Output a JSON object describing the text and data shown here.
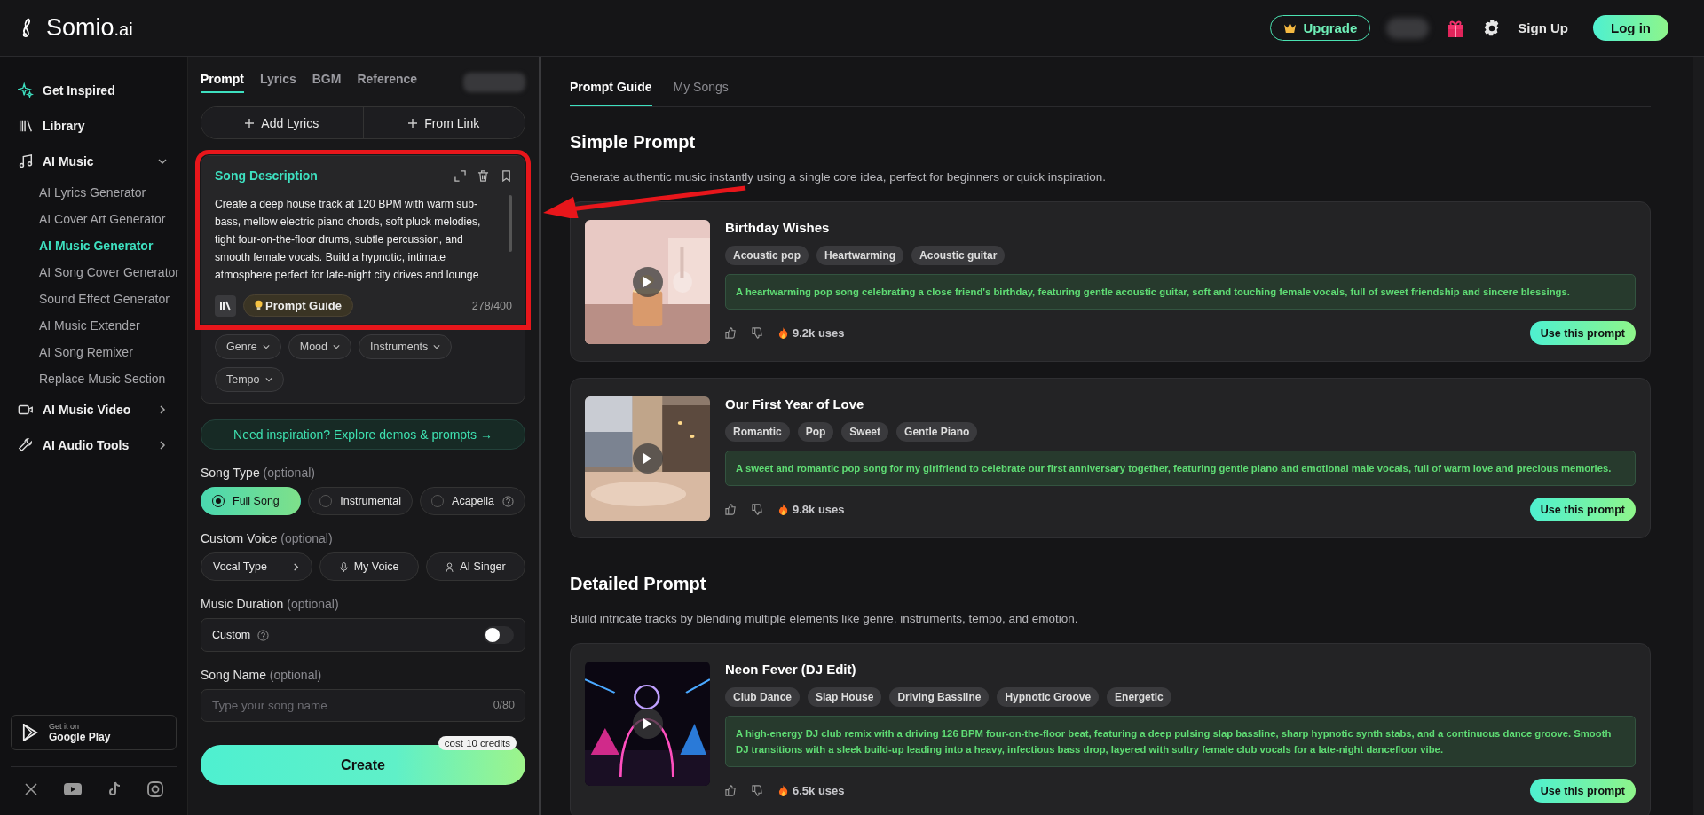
{
  "header": {
    "logo": "Somio",
    "logo_suffix": ".ai",
    "upgrade": "Upgrade",
    "sign_up": "Sign Up",
    "log_in": "Log in"
  },
  "sidebar": {
    "items": [
      {
        "label": "Get Inspired"
      },
      {
        "label": "Library"
      },
      {
        "label": "AI Music",
        "expanded": true,
        "children": [
          {
            "label": "AI Lyrics Generator",
            "selected": false
          },
          {
            "label": "AI Cover Art Generator",
            "selected": false
          },
          {
            "label": "AI Music Generator",
            "selected": true
          },
          {
            "label": "AI Song Cover Generator",
            "selected": false
          },
          {
            "label": "Sound Effect Generator",
            "selected": false
          },
          {
            "label": "AI Music Extender",
            "selected": false
          },
          {
            "label": "AI Song Remixer",
            "selected": false
          },
          {
            "label": "Replace Music Section",
            "selected": false
          }
        ]
      },
      {
        "label": "AI Music Video",
        "expanded": false
      },
      {
        "label": "AI Audio Tools",
        "expanded": false
      }
    ],
    "store": {
      "small": "Get it on",
      "big": "Google Play"
    }
  },
  "editor": {
    "tabs": [
      {
        "label": "Prompt",
        "selected": true
      },
      {
        "label": "Lyrics",
        "selected": false
      },
      {
        "label": "BGM",
        "selected": false
      },
      {
        "label": "Reference",
        "selected": false
      }
    ],
    "actions": [
      "Add Lyrics",
      "From Link"
    ],
    "description": {
      "title": "Song Description",
      "text": "Create a deep house track at 120 BPM with warm sub-bass, mellow electric piano chords, soft pluck melodies, tight four-on-the-floor drums, subtle percussion, and smooth female vocals. Build a hypnotic, intimate atmosphere perfect for late-night city drives and lounge",
      "guide": "Prompt Guide",
      "count": "278/400"
    },
    "filters": [
      "Genre",
      "Mood",
      "Instruments",
      "Tempo"
    ],
    "inspiration": "Need inspiration? Explore demos & prompts →",
    "song_type": {
      "label": "Song Type",
      "hint": "(optional)",
      "options": [
        {
          "label": "Full Song",
          "selected": true
        },
        {
          "label": "Instrumental",
          "selected": false
        },
        {
          "label": "Acapella",
          "selected": false
        }
      ]
    },
    "custom_voice": {
      "label": "Custom Voice",
      "hint": "(optional)",
      "buttons": [
        "Vocal Type",
        "My Voice",
        "AI Singer"
      ]
    },
    "duration": {
      "label": "Music Duration",
      "hint": "(optional)",
      "custom": "Custom",
      "on": false
    },
    "song_name": {
      "label": "Song Name",
      "hint": "(optional)",
      "placeholder": "Type your song name",
      "count": "0/80"
    },
    "create": {
      "label": "Create",
      "cost": "cost 10 credits"
    }
  },
  "guide": {
    "tabs": [
      {
        "label": "Prompt Guide",
        "selected": true
      },
      {
        "label": "My Songs",
        "selected": false
      }
    ],
    "sections": [
      {
        "title": "Simple Prompt",
        "subtitle": "Generate authentic music instantly using a single core idea, perfect for beginners or quick inspiration.",
        "cards": [
          {
            "title": "Birthday Wishes",
            "tags": [
              "Acoustic pop",
              "Heartwarming",
              "Acoustic guitar"
            ],
            "description": "A heartwarming pop song celebrating a close friend's birthday, featuring gentle acoustic guitar, soft and touching female vocals, full of sweet friendship and sincere blessings.",
            "uses": "9.2k uses",
            "button": "Use this prompt"
          },
          {
            "title": "Our First Year of Love",
            "tags": [
              "Romantic",
              "Pop",
              "Sweet",
              "Gentle Piano"
            ],
            "description": "A sweet and romantic pop song for my girlfriend to celebrate our first anniversary together, featuring gentle piano and emotional male vocals, full of warm love and precious memories.",
            "uses": "9.8k uses",
            "button": "Use this prompt"
          }
        ]
      },
      {
        "title": "Detailed Prompt",
        "subtitle": "Build intricate tracks by blending multiple elements like genre, instruments, tempo, and emotion.",
        "cards": [
          {
            "title": "Neon Fever (DJ Edit)",
            "tags": [
              "Club Dance",
              "Slap House",
              "Driving Bassline",
              "Hypnotic Groove",
              "Energetic"
            ],
            "description": "A high-energy DJ club remix with a driving 126 BPM four-on-the-floor beat, featuring a deep pulsing slap bassline, sharp hypnotic synth stabs, and a continuous dance groove. Smooth DJ transitions with a sleek build-up leading into a heavy, infectious bass drop, layered with sultry female club vocals for a late-night dancefloor vibe.",
            "uses": "6.5k uses",
            "button": "Use this prompt"
          }
        ]
      }
    ]
  }
}
